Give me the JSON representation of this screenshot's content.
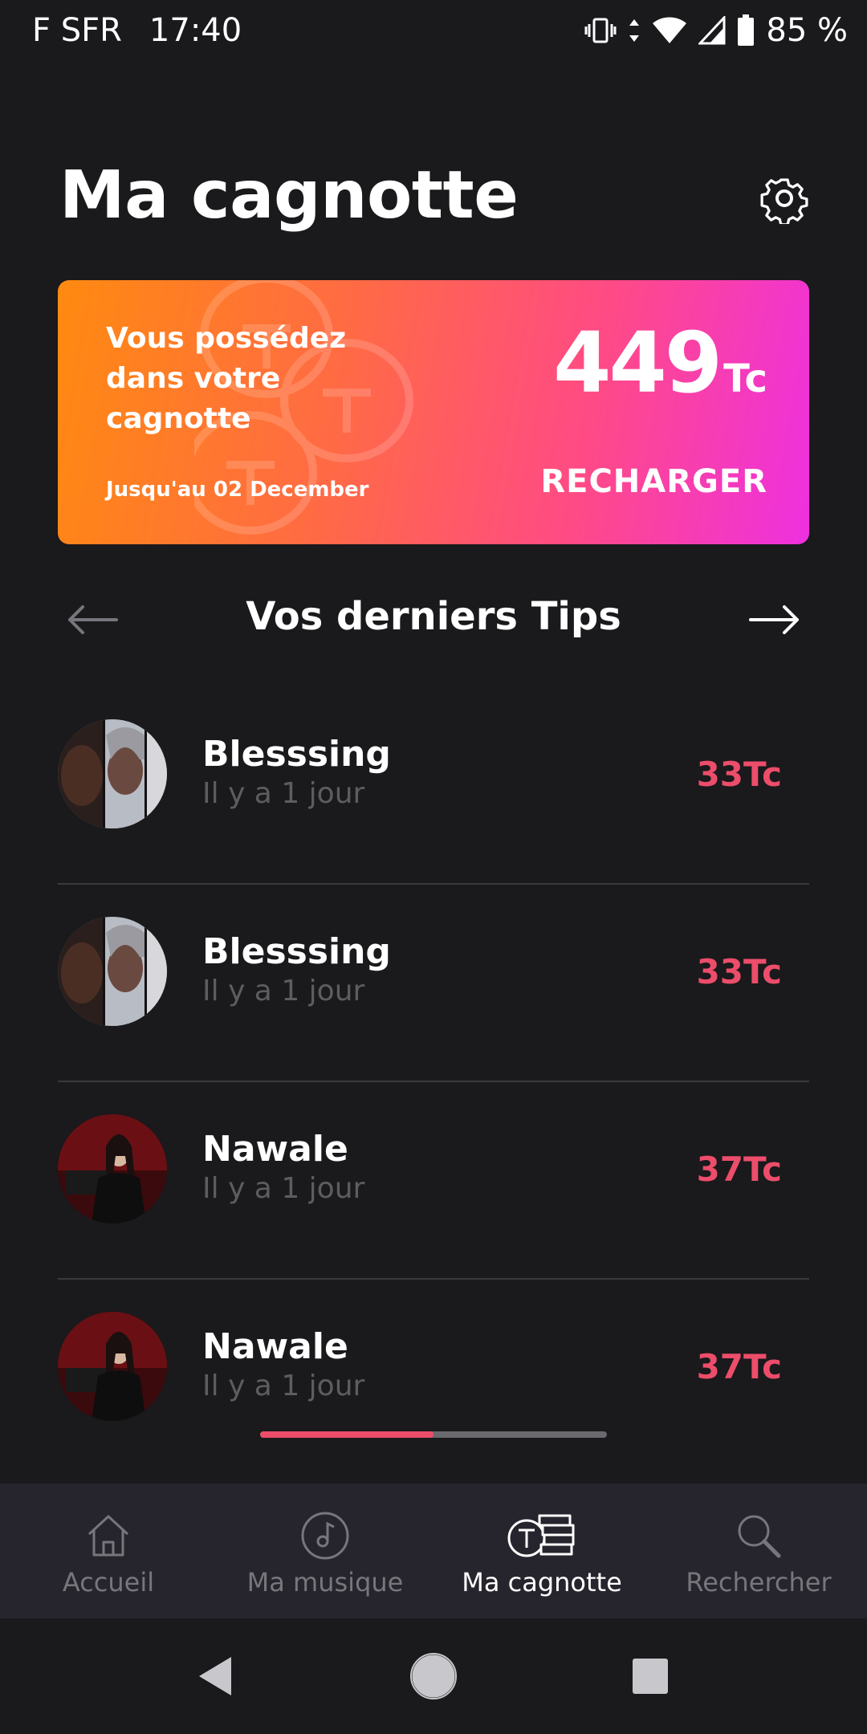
{
  "status_bar": {
    "carrier": "F SFR",
    "time": "17:40",
    "battery": "85 %"
  },
  "header": {
    "title": "Ma cagnotte",
    "settings_icon": "gear-icon"
  },
  "wallet": {
    "text": "Vous possédez dans votre cagnotte",
    "validity": "Jusqu'au 02 December",
    "amount": "449",
    "unit": "Tc",
    "recharge_label": "RECHARGER",
    "gradient": [
      "#ff8a10",
      "#ee30e0"
    ]
  },
  "tips_section": {
    "title": "Vos derniers Tips",
    "items": [
      {
        "name": "Blesssing",
        "time": "Il y a 1 jour",
        "amount": "33Tc"
      },
      {
        "name": "Blesssing",
        "time": "Il y a 1 jour",
        "amount": "33Tc"
      },
      {
        "name": "Nawale",
        "time": "Il y a 1 jour",
        "amount": "37Tc"
      },
      {
        "name": "Nawale",
        "time": "Il y a 1 jour",
        "amount": "37Tc"
      }
    ],
    "scroll_position": 0.5
  },
  "tabs": [
    {
      "label": "Accueil",
      "icon": "home-icon",
      "active": false
    },
    {
      "label": "Ma musique",
      "icon": "music-disc-icon",
      "active": false
    },
    {
      "label": "Ma cagnotte",
      "icon": "wallet-coins-icon",
      "active": true
    },
    {
      "label": "Rechercher",
      "icon": "search-icon",
      "active": false
    }
  ],
  "colors": {
    "background": "#1a191c",
    "accent": "#ec4d6a",
    "tab_bar": "#26252d"
  }
}
